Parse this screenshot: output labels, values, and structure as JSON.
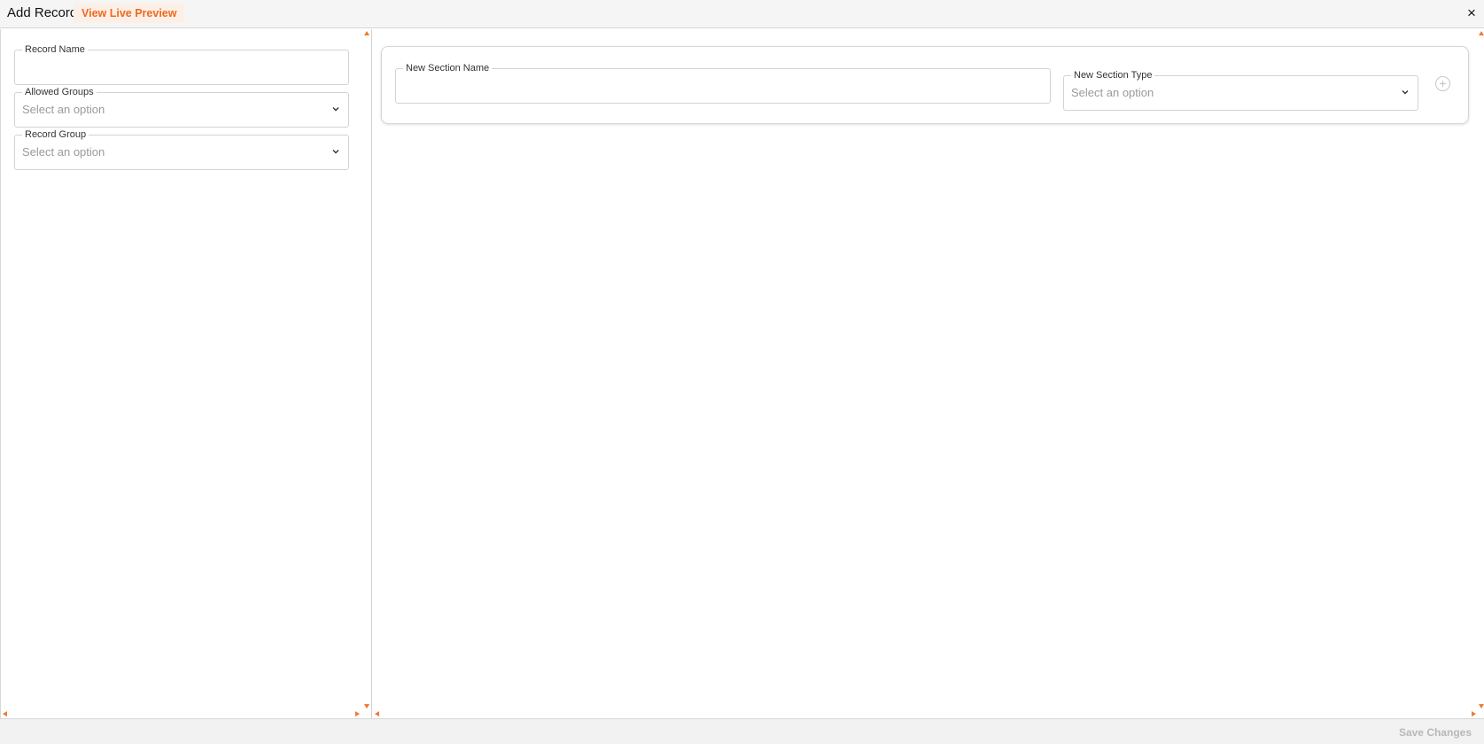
{
  "header": {
    "title": "Add Record",
    "preview_label": "View Live Preview",
    "close_label": "×"
  },
  "form": {
    "record_name": {
      "label": "Record Name",
      "value": ""
    },
    "allowed_groups": {
      "label": "Allowed Groups",
      "placeholder": "Select an option"
    },
    "record_group": {
      "label": "Record Group",
      "placeholder": "Select an option"
    }
  },
  "section": {
    "name": {
      "label": "New Section Name",
      "value": ""
    },
    "type": {
      "label": "New Section Type",
      "placeholder": "Select an option"
    },
    "add_icon": "plus-circle-icon"
  },
  "footer": {
    "save_label": "Save Changes"
  },
  "colors": {
    "accent": "#ee6a1f",
    "accent_bg": "#fcefe6",
    "disabled_text": "#b8b8b8",
    "placeholder": "#9a9a9a"
  }
}
